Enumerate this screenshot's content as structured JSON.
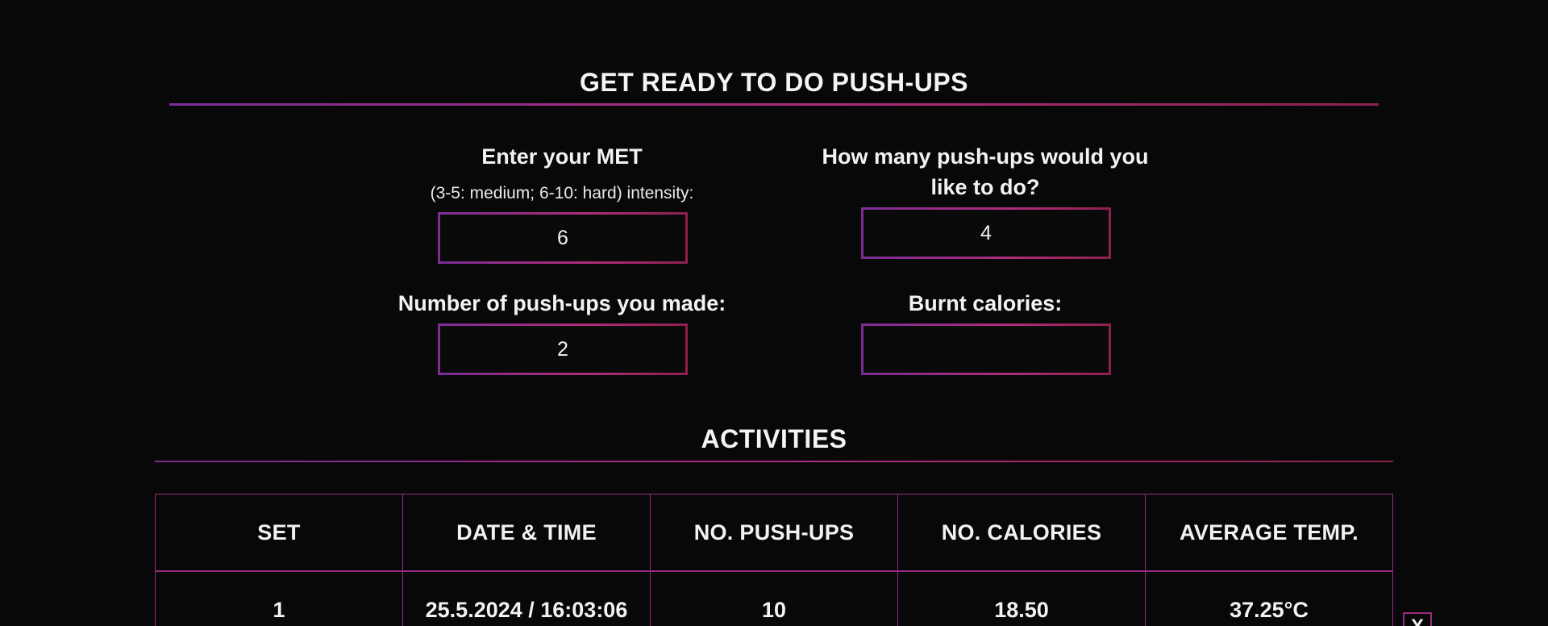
{
  "pushups_section": {
    "title": "GET READY TO DO PUSH-UPS",
    "met": {
      "label": "Enter your MET",
      "hint": "(3-5: medium; 6-10: hard) intensity:",
      "value": "6"
    },
    "target": {
      "label": "How many push-ups would you like to do?",
      "value": "4"
    },
    "made": {
      "label": "Number of push-ups you made:",
      "value": "2"
    },
    "calories": {
      "label": "Burnt calories:",
      "value": ""
    }
  },
  "activities_section": {
    "title": "ACTIVITIES",
    "columns": [
      "SET",
      "DATE & TIME",
      "NO. PUSH-UPS",
      "NO. CALORIES",
      "AVERAGE TEMP."
    ],
    "rows": [
      [
        "1",
        "25.5.2024 / 16:03:06",
        "10",
        "18.50",
        "37.25°C"
      ]
    ],
    "delete_icon": "close-icon",
    "delete_glyph": "X"
  },
  "colors": {
    "background": "#080808",
    "accent_purple": "#7b2d96",
    "accent_pink": "#b02c7a",
    "text": "#f2f2f2"
  }
}
